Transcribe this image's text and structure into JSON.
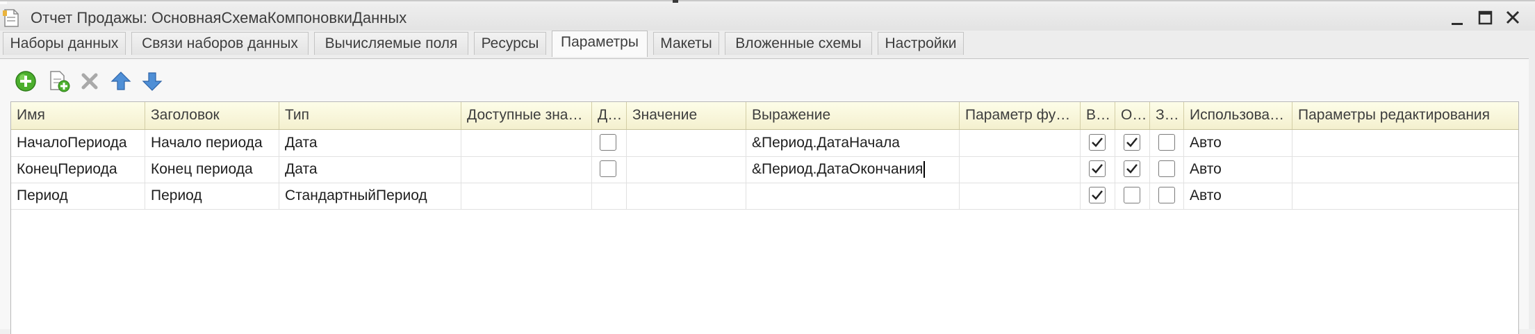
{
  "window": {
    "title": "Отчет Продажы: ОсновнаяСхемаКомпоновкиДанных"
  },
  "tabs": [
    {
      "label": "Наборы данных",
      "active": false
    },
    {
      "label": "Связи наборов данных",
      "active": false
    },
    {
      "label": "Вычисляемые поля",
      "active": false
    },
    {
      "label": "Ресурсы",
      "active": false
    },
    {
      "label": "Параметры",
      "active": true
    },
    {
      "label": "Макеты",
      "active": false
    },
    {
      "label": "Вложенные схемы",
      "active": false
    },
    {
      "label": "Настройки",
      "active": false
    }
  ],
  "toolbar": {
    "icons": [
      "add-icon",
      "copy-icon",
      "delete-icon",
      "move-up-icon",
      "move-down-icon"
    ],
    "colors": {
      "add": "#4caf2e",
      "arrow": "#4f8fd6",
      "delete": "#a9a9a9"
    }
  },
  "table": {
    "columns": [
      "Имя",
      "Заголовок",
      "Тип",
      "Доступные зна…",
      "Д…",
      "Значение",
      "Выражение",
      "Параметр фу…",
      "В…",
      "О…",
      "З…",
      "Использова…",
      "Параметры редактирования"
    ],
    "rows": [
      {
        "name": "НачалоПериода",
        "title": "Начало периода",
        "type": "Дата",
        "available": "",
        "d": false,
        "value": "",
        "expression": "&Период.ДатаНачала",
        "func_param": "",
        "v": true,
        "o": true,
        "z": false,
        "usage": "Авто",
        "edit_params": ""
      },
      {
        "name": "КонецПериода",
        "title": "Конец периода",
        "type": "Дата",
        "available": "",
        "d": false,
        "value": "",
        "expression": "&Период.ДатаОкончания",
        "func_param": "",
        "v": true,
        "o": true,
        "z": false,
        "usage": "Авто",
        "edit_params": ""
      },
      {
        "name": "Период",
        "title": "Период",
        "type": "СтандартныйПериод",
        "available": "",
        "d": null,
        "value": "",
        "expression": "",
        "func_param": "",
        "v": true,
        "o": false,
        "z": false,
        "usage": "Авто",
        "edit_params": ""
      }
    ],
    "header_color": "#f7f4d8"
  }
}
